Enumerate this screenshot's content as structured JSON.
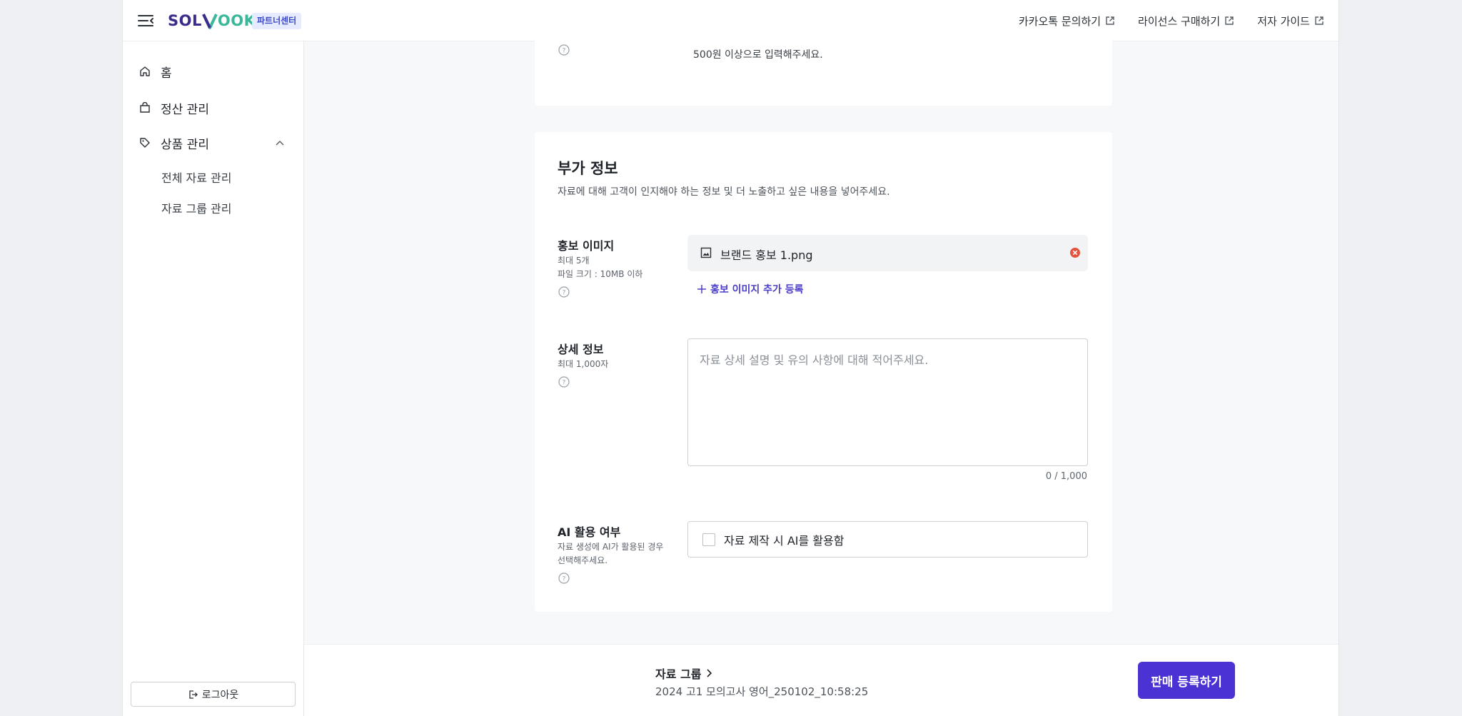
{
  "header": {
    "logo_left": "SOL",
    "logo_right": "OOK",
    "partner_badge": "파트너센터",
    "links": [
      {
        "label": "카카오톡 문의하기"
      },
      {
        "label": "라이선스 구매하기"
      },
      {
        "label": "저자 가이드"
      }
    ]
  },
  "sidebar": {
    "items": [
      {
        "label": "홈"
      },
      {
        "label": "정산 관리"
      },
      {
        "label": "상품 관리"
      }
    ],
    "sub_items": [
      {
        "label": "전체 자료 관리"
      },
      {
        "label": "자료 그룹 관리"
      }
    ],
    "logout_label": "로그아웃"
  },
  "previous_section": {
    "note": "500원 이상으로 입력해주세요."
  },
  "extra_info": {
    "title": "부가 정보",
    "description": "자료에 대해 고객이 인지해야 하는 정보 및 더 노출하고 싶은 내용을 넣어주세요.",
    "promo_image": {
      "label": "홍보 이미지",
      "sub1": "최대 5개",
      "sub2": "파일 크기 : 10MB 이하",
      "file_name": "브랜드 홍보 1.png",
      "add_label": "홍보 이미지 추가 등록"
    },
    "detail": {
      "label": "상세 정보",
      "sub": "최대 1,000자",
      "placeholder": "자료 상세 설명 및 유의 사항에 대해 적어주세요.",
      "value": "",
      "count": "0 / 1,000"
    },
    "ai": {
      "label": "AI 활용 여부",
      "sub1": "자료 생성에 AI가 활용된 경우",
      "sub2": "선택해주세요.",
      "checkbox_label": "자료 제작 시 AI를 활용함",
      "checked": false
    }
  },
  "footer": {
    "group_label": "자료 그룹",
    "group_value": "2024 고1 모의고사 영어_250102_10:58:25",
    "register_label": "판매 등록하기"
  },
  "colors": {
    "accent": "#4b32d2",
    "link_purple": "#4b3ec8",
    "logo_purple": "#3a2b8c",
    "logo_green": "#3bb89a",
    "remove_red": "#e5533d"
  }
}
